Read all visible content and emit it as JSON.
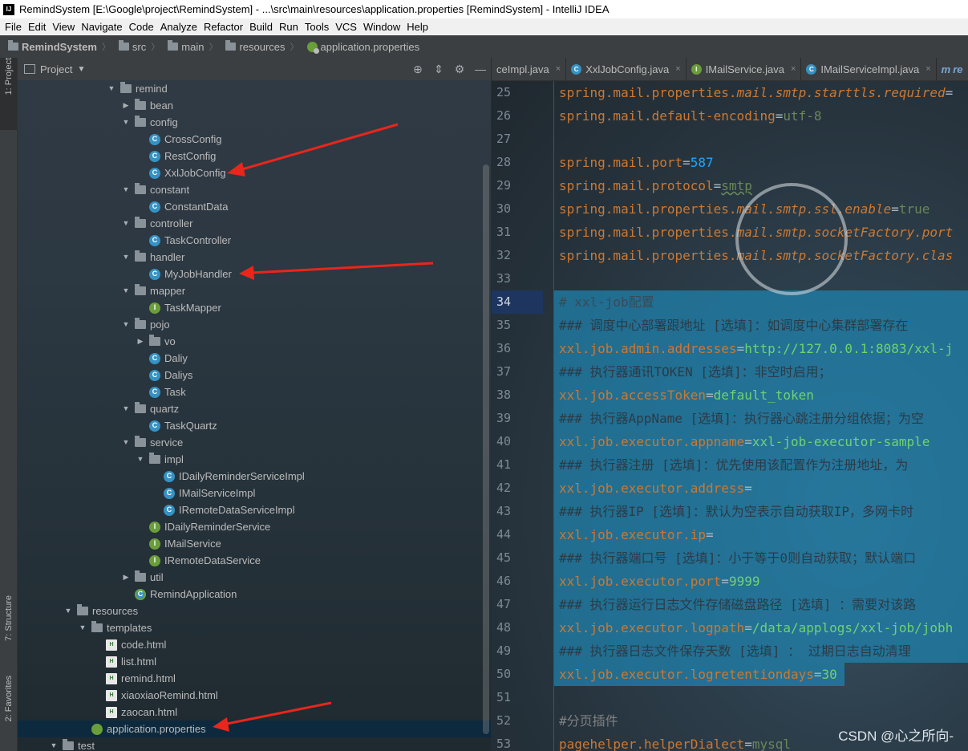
{
  "window": {
    "title": "RemindSystem [E:\\Google\\project\\RemindSystem] - ...\\src\\main\\resources\\application.properties [RemindSystem] - IntelliJ IDEA",
    "logo": "IJ"
  },
  "menu": [
    "File",
    "Edit",
    "View",
    "Navigate",
    "Code",
    "Analyze",
    "Refactor",
    "Build",
    "Run",
    "Tools",
    "VCS",
    "Window",
    "Help"
  ],
  "breadcrumb": [
    "RemindSystem",
    "src",
    "main",
    "resources",
    "application.properties"
  ],
  "left_tabs": {
    "project": "1: Project",
    "structure": "7: Structure",
    "favorites": "2: Favorites"
  },
  "project_panel": {
    "title": "Project"
  },
  "tree": [
    {
      "label": "remind",
      "icon": "folder",
      "depth": 0,
      "exp": "down"
    },
    {
      "label": "bean",
      "icon": "folder",
      "depth": 1,
      "exp": "right"
    },
    {
      "label": "config",
      "icon": "folder",
      "depth": 1,
      "exp": "down"
    },
    {
      "label": "CrossConfig",
      "icon": "class",
      "depth": 2,
      "exp": ""
    },
    {
      "label": "RestConfig",
      "icon": "class",
      "depth": 2,
      "exp": ""
    },
    {
      "label": "XxlJobConfig",
      "icon": "class",
      "depth": 2,
      "exp": ""
    },
    {
      "label": "constant",
      "icon": "folder",
      "depth": 1,
      "exp": "down"
    },
    {
      "label": "ConstantData",
      "icon": "class",
      "depth": 2,
      "exp": ""
    },
    {
      "label": "controller",
      "icon": "folder",
      "depth": 1,
      "exp": "down"
    },
    {
      "label": "TaskController",
      "icon": "class",
      "depth": 2,
      "exp": ""
    },
    {
      "label": "handler",
      "icon": "folder",
      "depth": 1,
      "exp": "down"
    },
    {
      "label": "MyJobHandler",
      "icon": "class",
      "depth": 2,
      "exp": ""
    },
    {
      "label": "mapper",
      "icon": "folder",
      "depth": 1,
      "exp": "down"
    },
    {
      "label": "TaskMapper",
      "icon": "iface",
      "depth": 2,
      "exp": ""
    },
    {
      "label": "pojo",
      "icon": "folder",
      "depth": 1,
      "exp": "down"
    },
    {
      "label": "vo",
      "icon": "folder",
      "depth": 2,
      "exp": "right"
    },
    {
      "label": "Daliy",
      "icon": "class",
      "depth": 2,
      "exp": ""
    },
    {
      "label": "Daliys",
      "icon": "class",
      "depth": 2,
      "exp": ""
    },
    {
      "label": "Task",
      "icon": "class",
      "depth": 2,
      "exp": ""
    },
    {
      "label": "quartz",
      "icon": "folder",
      "depth": 1,
      "exp": "down"
    },
    {
      "label": "TaskQuartz",
      "icon": "class",
      "depth": 2,
      "exp": ""
    },
    {
      "label": "service",
      "icon": "folder",
      "depth": 1,
      "exp": "down"
    },
    {
      "label": "impl",
      "icon": "folder",
      "depth": 2,
      "exp": "down"
    },
    {
      "label": "IDailyReminderServiceImpl",
      "icon": "class",
      "depth": 3,
      "exp": ""
    },
    {
      "label": "IMailServiceImpl",
      "icon": "class",
      "depth": 3,
      "exp": ""
    },
    {
      "label": "IRemoteDataServiceImpl",
      "icon": "class",
      "depth": 3,
      "exp": ""
    },
    {
      "label": "IDailyReminderService",
      "icon": "iface",
      "depth": 2,
      "exp": ""
    },
    {
      "label": "IMailService",
      "icon": "iface",
      "depth": 2,
      "exp": ""
    },
    {
      "label": "IRemoteDataService",
      "icon": "iface",
      "depth": 2,
      "exp": ""
    },
    {
      "label": "util",
      "icon": "folder",
      "depth": 1,
      "exp": "right"
    },
    {
      "label": "RemindApplication",
      "icon": "boot",
      "depth": 1,
      "exp": ""
    },
    {
      "label": "resources",
      "icon": "folder",
      "depth": -3,
      "exp": "down"
    },
    {
      "label": "templates",
      "icon": "folder",
      "depth": -2,
      "exp": "down"
    },
    {
      "label": "code.html",
      "icon": "html",
      "depth": -1,
      "exp": ""
    },
    {
      "label": "list.html",
      "icon": "html",
      "depth": -1,
      "exp": ""
    },
    {
      "label": "remind.html",
      "icon": "html",
      "depth": -1,
      "exp": ""
    },
    {
      "label": "xiaoxiaoRemind.html",
      "icon": "html",
      "depth": -1,
      "exp": ""
    },
    {
      "label": "zaocan.html",
      "icon": "html",
      "depth": -1,
      "exp": ""
    },
    {
      "label": "application.properties",
      "icon": "props",
      "depth": -2,
      "exp": "",
      "selected": true
    },
    {
      "label": "test",
      "icon": "folder",
      "depth": -4,
      "exp": "down"
    }
  ],
  "editor_tabs": [
    {
      "label": "ceImpl.java",
      "icon": "",
      "color": ""
    },
    {
      "label": "XxlJobConfig.java",
      "icon": "C",
      "color": "#3592c4"
    },
    {
      "label": "IMailService.java",
      "icon": "I",
      "color": "#6a9e3a"
    },
    {
      "label": "IMailServiceImpl.java",
      "icon": "C",
      "color": "#3592c4"
    },
    {
      "label": "re",
      "icon": "m",
      "color": ""
    }
  ],
  "current_line": 34,
  "code_lines": [
    {
      "n": 25,
      "parts": [
        [
          "k",
          "spring.mail."
        ],
        [
          "k",
          "properties."
        ],
        [
          "kp",
          "mail.smtp.starttls.required"
        ],
        [
          "eq",
          "="
        ]
      ]
    },
    {
      "n": 26,
      "parts": [
        [
          "k",
          "spring.mail.default-encoding"
        ],
        [
          "eq",
          "="
        ],
        [
          "v",
          "utf-8"
        ]
      ]
    },
    {
      "n": 27,
      "parts": []
    },
    {
      "n": 28,
      "parts": [
        [
          "k",
          "spring.mail.port"
        ],
        [
          "eq",
          "="
        ],
        [
          "num",
          "587"
        ]
      ]
    },
    {
      "n": 29,
      "parts": [
        [
          "k",
          "spring.mail.protocol"
        ],
        [
          "eq",
          "="
        ],
        [
          "v",
          "smtp"
        ]
      ]
    },
    {
      "n": 30,
      "parts": [
        [
          "k",
          "spring.mail.properties."
        ],
        [
          "kp",
          "mail.smtp.ssl.enable"
        ],
        [
          "eq",
          "="
        ],
        [
          "v",
          "true"
        ]
      ]
    },
    {
      "n": 31,
      "parts": [
        [
          "k",
          "spring.mail.properties."
        ],
        [
          "kp",
          "mail.smtp.socketFactory.port"
        ]
      ]
    },
    {
      "n": 32,
      "parts": [
        [
          "k",
          "spring.mail.properties."
        ],
        [
          "kp",
          "mail.smtp.socketFactory.clas"
        ]
      ]
    },
    {
      "n": 33,
      "parts": []
    },
    {
      "n": 34,
      "hl": true,
      "parts": [
        [
          "ch",
          "# xxl-job配置"
        ]
      ]
    },
    {
      "n": 35,
      "hl": true,
      "parts": [
        [
          "ch2",
          "### 调度中心部署跟地址 [选填]：如调度中心集群部署存在"
        ]
      ]
    },
    {
      "n": 36,
      "hl": true,
      "parts": [
        [
          "kh",
          "xxl.job.admin.addresses"
        ],
        [
          "eq",
          "="
        ],
        [
          "vh",
          "http://127.0.0.1:8083/xxl-j"
        ]
      ]
    },
    {
      "n": 37,
      "hl": true,
      "parts": [
        [
          "ch2",
          "### 执行器通讯TOKEN [选填]：非空时启用；"
        ]
      ]
    },
    {
      "n": 38,
      "hl": true,
      "parts": [
        [
          "kh",
          "xxl.job.accessToken"
        ],
        [
          "eq",
          "="
        ],
        [
          "vh",
          "default_token"
        ]
      ]
    },
    {
      "n": 39,
      "hl": true,
      "parts": [
        [
          "ch2",
          "### 执行器AppName [选填]：执行器心跳注册分组依据；为空"
        ]
      ]
    },
    {
      "n": 40,
      "hl": true,
      "parts": [
        [
          "kh",
          "xxl.job.executor.appname"
        ],
        [
          "eq",
          "="
        ],
        [
          "vh",
          "xxl-job-executor-sample"
        ]
      ]
    },
    {
      "n": 41,
      "hl": true,
      "parts": [
        [
          "ch2",
          "### 执行器注册 [选填]：优先使用该配置作为注册地址，为"
        ]
      ]
    },
    {
      "n": 42,
      "hl": true,
      "parts": [
        [
          "kh",
          "xxl.job.executor.address"
        ],
        [
          "eq",
          "="
        ]
      ]
    },
    {
      "n": 43,
      "hl": true,
      "parts": [
        [
          "ch2",
          "### 执行器IP [选填]：默认为空表示自动获取IP，多网卡时"
        ]
      ]
    },
    {
      "n": 44,
      "hl": true,
      "parts": [
        [
          "kh",
          "xxl.job.executor.ip"
        ],
        [
          "eq",
          "="
        ]
      ]
    },
    {
      "n": 45,
      "hl": true,
      "parts": [
        [
          "ch2",
          "### 执行器端口号 [选填]：小于等于0则自动获取；默认端口"
        ]
      ]
    },
    {
      "n": 46,
      "hl": true,
      "parts": [
        [
          "kh",
          "xxl.job.executor.port"
        ],
        [
          "eq",
          "="
        ],
        [
          "vh",
          "9999"
        ]
      ]
    },
    {
      "n": 47,
      "hl": true,
      "parts": [
        [
          "ch2",
          "### 执行器运行日志文件存储磁盘路径 [选填] ：需要对该路"
        ]
      ]
    },
    {
      "n": 48,
      "hl": true,
      "parts": [
        [
          "kh",
          "xxl.job.executor.logpath"
        ],
        [
          "eq",
          "="
        ],
        [
          "vh",
          "/data/applogs/xxl-job/jobh"
        ]
      ]
    },
    {
      "n": 49,
      "hl": true,
      "parts": [
        [
          "ch2",
          "### 执行器日志文件保存天数 [选填] ： 过期日志自动清理"
        ]
      ]
    },
    {
      "n": 50,
      "hl": true,
      "short": true,
      "parts": [
        [
          "kh",
          "xxl.job.executor.logretentiondays"
        ],
        [
          "eq",
          "="
        ],
        [
          "vh",
          "30"
        ]
      ]
    },
    {
      "n": 51,
      "parts": []
    },
    {
      "n": 52,
      "parts": [
        [
          "cm",
          "#分页插件"
        ]
      ]
    },
    {
      "n": 53,
      "parts": [
        [
          "k",
          "pagehelper.helperDialect"
        ],
        [
          "eq",
          "="
        ],
        [
          "v",
          "mysql"
        ]
      ]
    }
  ],
  "watermark": "CSDN @心之所向-",
  "colors": {
    "accent_arrow": "#e8261c",
    "selection": "#1f84b0",
    "keyword": "#cc7832",
    "value": "#6a8759"
  }
}
